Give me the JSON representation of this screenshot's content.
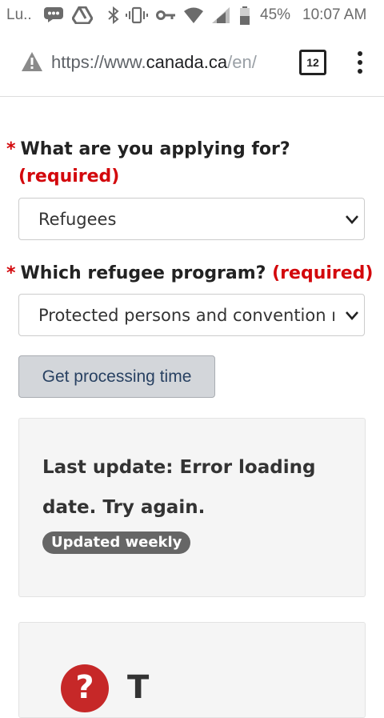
{
  "status_bar": {
    "app_label": "Lu..",
    "battery_pct": "45%",
    "time": "10:07 AM"
  },
  "browser": {
    "url_scheme": "https://www.",
    "url_domain": "canada.ca",
    "url_rest": "/en/",
    "tab_count": "12"
  },
  "form": {
    "q1": {
      "star": "*",
      "label": "What are you applying for?",
      "required": "(required)",
      "value": "Refugees"
    },
    "q2": {
      "star": "*",
      "label": "Which refugee program?",
      "required": "(required)",
      "value": "Protected persons and convention refugees"
    },
    "submit_label": "Get processing time"
  },
  "result": {
    "text": "Last update: Error loading date. Try again.",
    "badge": "Updated weekly"
  },
  "help": {
    "icon_glyph": "?",
    "partial_title": "T"
  }
}
